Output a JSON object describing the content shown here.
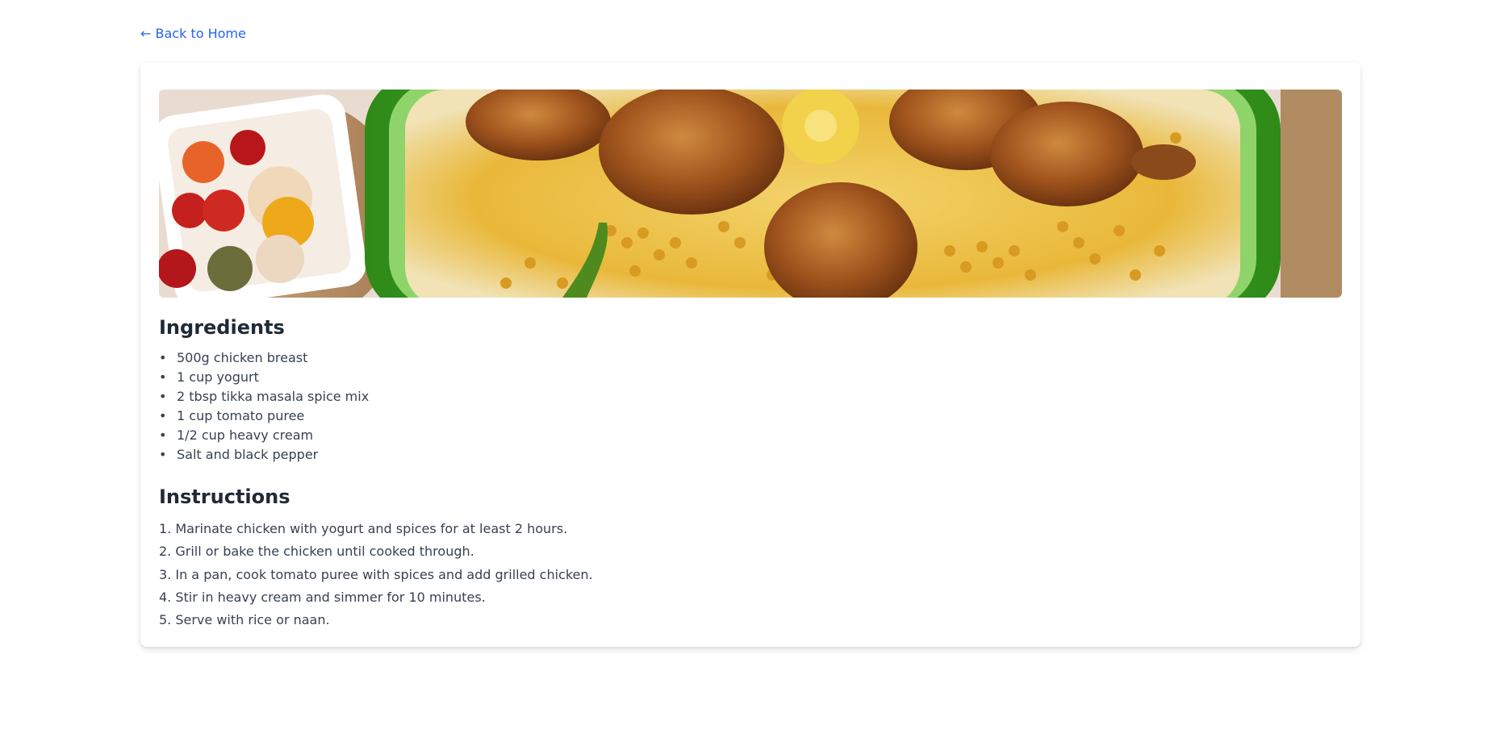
{
  "nav": {
    "back_label": "← Back to Home"
  },
  "recipe": {
    "ingredients_heading": "Ingredients",
    "ingredients": [
      "500g chicken breast",
      "1 cup yogurt",
      "2 tbsp tikka masala spice mix",
      "1 cup tomato puree",
      "1/2 cup heavy cream",
      "Salt and black pepper"
    ],
    "instructions_heading": "Instructions",
    "instructions": [
      "1. Marinate chicken with yogurt and spices for at least 2 hours.",
      "2. Grill or bake the chicken until cooked through.",
      "3. In a pan, cook tomato puree with spices and add grilled chicken.",
      "4. Stir in heavy cream and simmer for 10 minutes.",
      "5. Serve with rice or naan."
    ]
  },
  "colors": {
    "link": "#2563eb",
    "heading": "#1f2937",
    "body_text": "#374151",
    "platter_green": "#3fa51f",
    "rice_yellow": "#e9b83a",
    "chicken_brown": "#a0541d"
  }
}
